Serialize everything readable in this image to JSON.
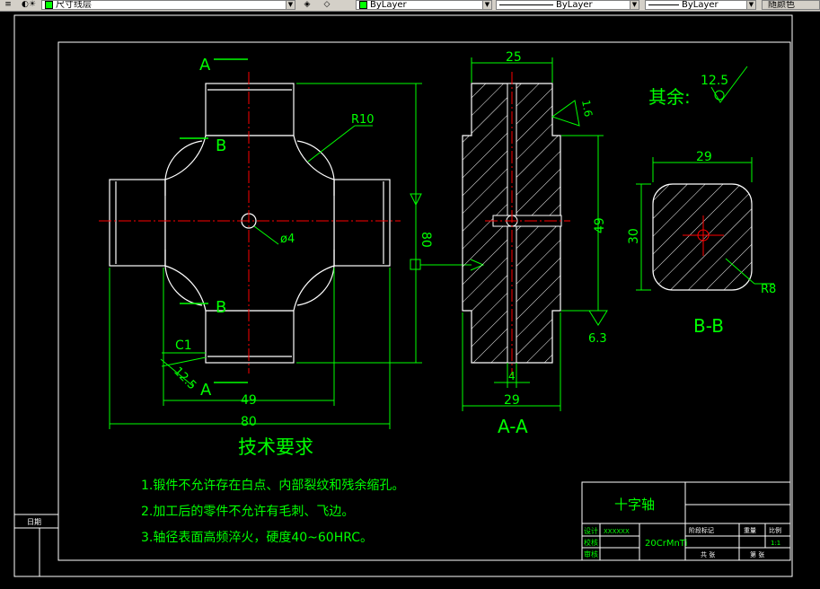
{
  "toolbar": {
    "layer_name": "尺寸线层",
    "color_control": "ByLayer",
    "linetype_control": "ByLayer",
    "lineweight_control": "ByLayer",
    "plotstyle_control": "随颜色",
    "colors": {
      "toolbar_bg": "#d4d0c8",
      "layer_swatch": "#00ff00"
    }
  },
  "drawing": {
    "colors": {
      "background": "#000000",
      "outline": "#ffffff",
      "dimension": "#00ff00",
      "centerline": "#ff0000",
      "hatch": "#ffffff"
    },
    "section_marker": "A",
    "section_bb_marker": "B",
    "labels": {
      "section_aa": "A-A",
      "section_bb": "B-B",
      "remaining_roughness_label": "其余:",
      "remaining_roughness_value": "12.5"
    },
    "dimensions": {
      "fillet_r10": "R10",
      "hole_d4": "ø4",
      "chamfer_c1": "C1",
      "roughness_left": "12.5",
      "height_80": "80",
      "width_49": "49",
      "width_80": "80",
      "aa_top_25": "25",
      "aa_height_49": "49",
      "aa_hole_4": "4",
      "aa_bottom_29": "29",
      "roughness_1_6": "1.6",
      "roughness_6_3": "6.3",
      "bb_width_29": "29",
      "bb_height_30": "30",
      "bb_r8": "R8"
    },
    "requirements": {
      "title": "技术要求",
      "items": [
        "1.锻件不允许存在白点、内部裂纹和残余缩孔。",
        "2.加工后的零件不允许有毛刺、飞边。",
        "3.轴径表面高频淬火，硬度40~60HRC。"
      ]
    },
    "title_block": {
      "part_name": "十字轴",
      "material": "20CrMnTi",
      "roles": [
        "设计",
        "校核",
        "审核"
      ],
      "designer": "XXXXXX",
      "header_cells": [
        "阶段标记",
        "重量",
        "比例"
      ],
      "scale": "1:1",
      "sheet_info": [
        "共 张",
        "第 张"
      ]
    },
    "side_label": "日期"
  }
}
